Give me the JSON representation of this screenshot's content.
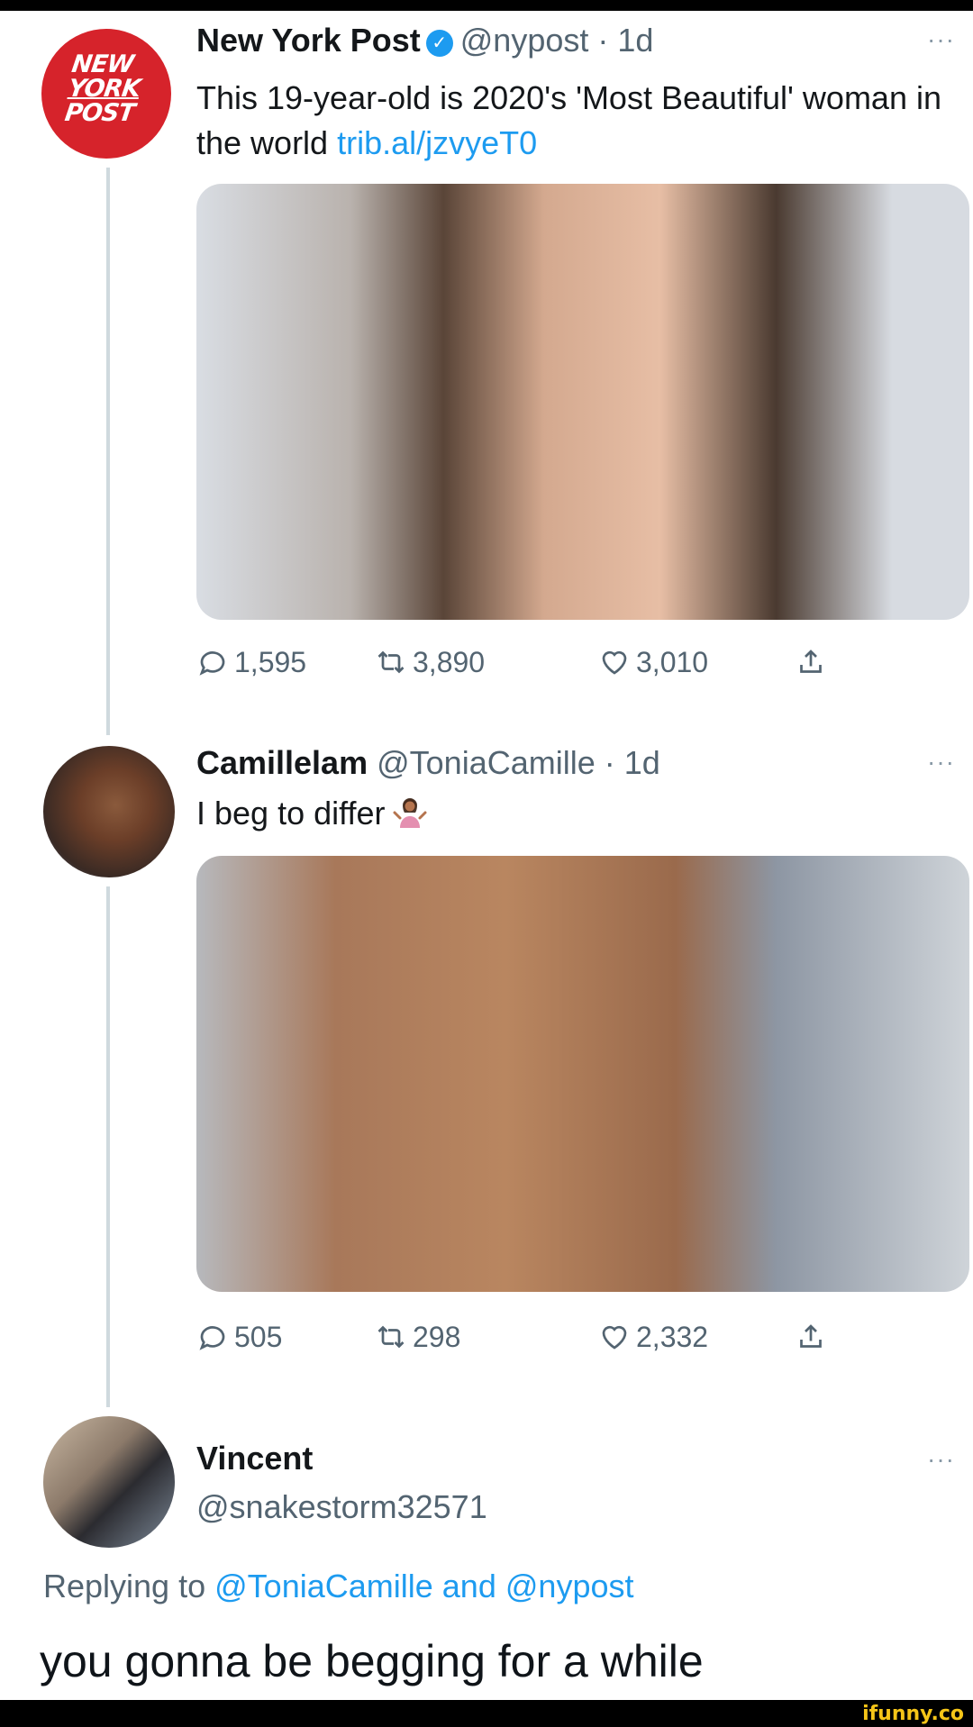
{
  "tweet1": {
    "name": "New York Post",
    "handle": "@nypost · 1d",
    "text": "This 19-year-old is 2020's 'Most Beautiful' woman in the world",
    "link": "trib.al/jzvyeT0",
    "logo_text": [
      "NEW",
      "YORK",
      "POST"
    ],
    "stats": {
      "replies": "1,595",
      "retweets": "3,890",
      "likes": "3,010"
    },
    "more": "···"
  },
  "tweet2": {
    "name": "Camillelam",
    "handle": "@ToniaCamille · 1d",
    "text": "I beg to differ",
    "emoji": "person-shrugging-emoji",
    "stats": {
      "replies": "505",
      "retweets": "298",
      "likes": "2,332"
    },
    "more": "···"
  },
  "tweet3": {
    "name": "Vincent",
    "handle": "@snakestorm32571",
    "replying_prefix": "Replying to",
    "replying_to_1": "@ToniaCamille",
    "replying_and": "and",
    "replying_to_2": "@nypost",
    "text": "you gonna be begging for a while",
    "more": "···"
  },
  "watermark": "ifunny.co",
  "colors": {
    "link": "#1d9bf0",
    "verified": "#1d9bf0",
    "nyp_red": "#d6232b",
    "muted": "#536471"
  },
  "icons": [
    "verified-badge-icon",
    "reply-icon",
    "retweet-icon",
    "like-icon",
    "share-icon",
    "more-icon"
  ]
}
